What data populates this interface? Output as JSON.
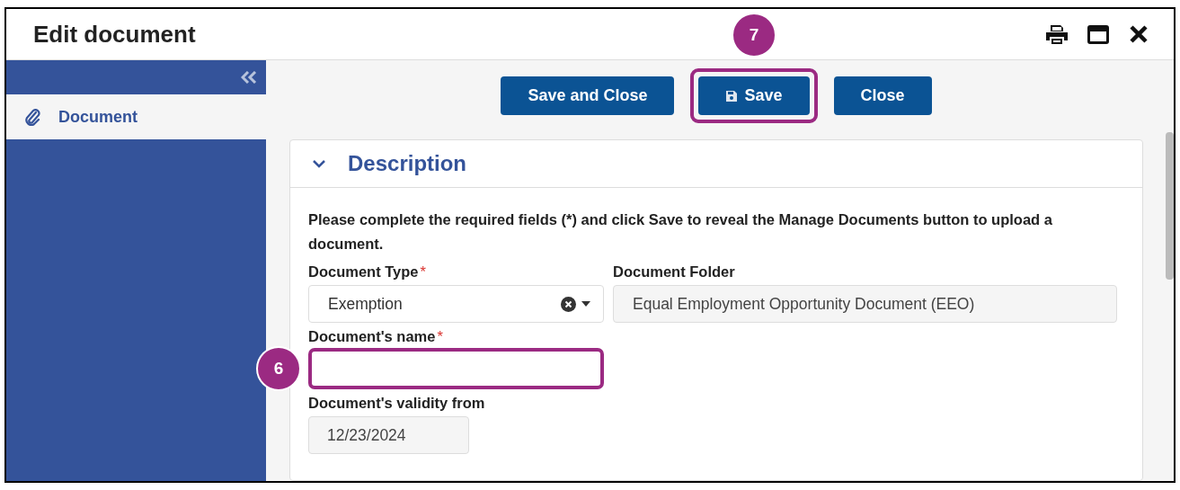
{
  "window": {
    "title": "Edit document"
  },
  "sidebar": {
    "items": [
      {
        "label": "Document",
        "selected": true
      }
    ]
  },
  "toolbar": {
    "buttons": [
      {
        "label": "Save and Close",
        "kind": "text",
        "highlighted": false
      },
      {
        "label": "Save",
        "kind": "icon",
        "highlighted": true,
        "callout": "7"
      },
      {
        "label": "Close",
        "kind": "text",
        "highlighted": false
      }
    ]
  },
  "section": {
    "title": "Description",
    "expanded": true,
    "instruction": "Please complete the required fields (*) and click Save to reveal the Manage Documents button to upload a document.",
    "fields": [
      {
        "kind": "select",
        "label": "Document Type",
        "required_mark": "*",
        "value": "Exemption",
        "highlighted": false
      },
      {
        "kind": "readonly",
        "label": "Document Folder",
        "value": "Equal Employment Opportunity Document (EEO)",
        "highlighted": false
      },
      {
        "kind": "text",
        "label": "Document's name",
        "required_mark": "*",
        "highlighted": true,
        "callout": "6"
      },
      {
        "kind": "date",
        "label": "Document's validity from",
        "value": "12/23/2024",
        "highlighted": false
      }
    ]
  }
}
